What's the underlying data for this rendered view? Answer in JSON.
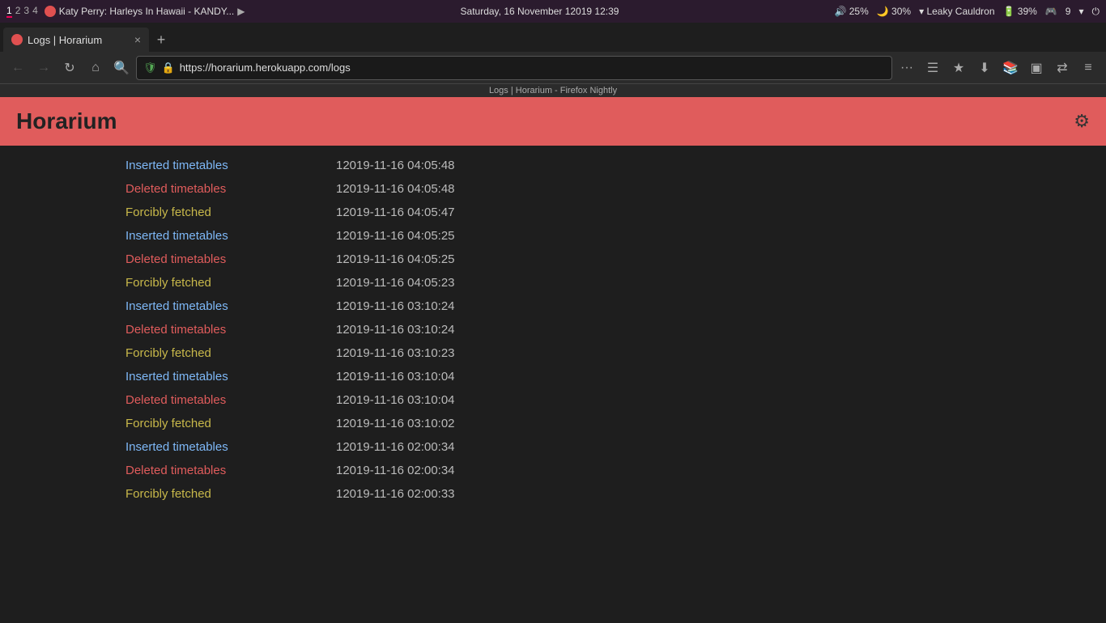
{
  "os": {
    "workspaces": [
      "1",
      "2",
      "3",
      "4"
    ],
    "active_workspace": "1",
    "media": "Katy Perry: Harleys In Hawaii - KANDY...",
    "datetime": "Saturday, 16 November 12019 12:39",
    "volume": "25%",
    "moon": "30%",
    "wifi": "Leaky Cauldron",
    "battery": "39%",
    "titlebar_center": "Logs | Horarium - Firefox Nightly"
  },
  "browser": {
    "tab_title": "Logs | Horarium",
    "tab_new_label": "+",
    "tab_close_label": "×",
    "url": "https://horarium.herokuapp.com/logs",
    "page_subtitle": "Logs | Horarium - Firefox Nightly"
  },
  "app": {
    "title": "Horarium",
    "gear_label": "⚙"
  },
  "logs": [
    {
      "type": "inserted",
      "label": "Inserted timetables",
      "timestamp": "12019-11-16 04:05:48"
    },
    {
      "type": "deleted",
      "label": "Deleted timetables",
      "timestamp": "12019-11-16 04:05:48"
    },
    {
      "type": "fetched",
      "label": "Forcibly fetched",
      "timestamp": "12019-11-16 04:05:47"
    },
    {
      "type": "inserted",
      "label": "Inserted timetables",
      "timestamp": "12019-11-16 04:05:25"
    },
    {
      "type": "deleted",
      "label": "Deleted timetables",
      "timestamp": "12019-11-16 04:05:25"
    },
    {
      "type": "fetched",
      "label": "Forcibly fetched",
      "timestamp": "12019-11-16 04:05:23"
    },
    {
      "type": "inserted",
      "label": "Inserted timetables",
      "timestamp": "12019-11-16 03:10:24"
    },
    {
      "type": "deleted",
      "label": "Deleted timetables",
      "timestamp": "12019-11-16 03:10:24"
    },
    {
      "type": "fetched",
      "label": "Forcibly fetched",
      "timestamp": "12019-11-16 03:10:23"
    },
    {
      "type": "inserted",
      "label": "Inserted timetables",
      "timestamp": "12019-11-16 03:10:04"
    },
    {
      "type": "deleted",
      "label": "Deleted timetables",
      "timestamp": "12019-11-16 03:10:04"
    },
    {
      "type": "fetched",
      "label": "Forcibly fetched",
      "timestamp": "12019-11-16 03:10:02"
    },
    {
      "type": "inserted",
      "label": "Inserted timetables",
      "timestamp": "12019-11-16 02:00:34"
    },
    {
      "type": "deleted",
      "label": "Deleted timetables",
      "timestamp": "12019-11-16 02:00:34"
    },
    {
      "type": "fetched",
      "label": "Forcibly fetched",
      "timestamp": "12019-11-16 02:00:33"
    }
  ]
}
